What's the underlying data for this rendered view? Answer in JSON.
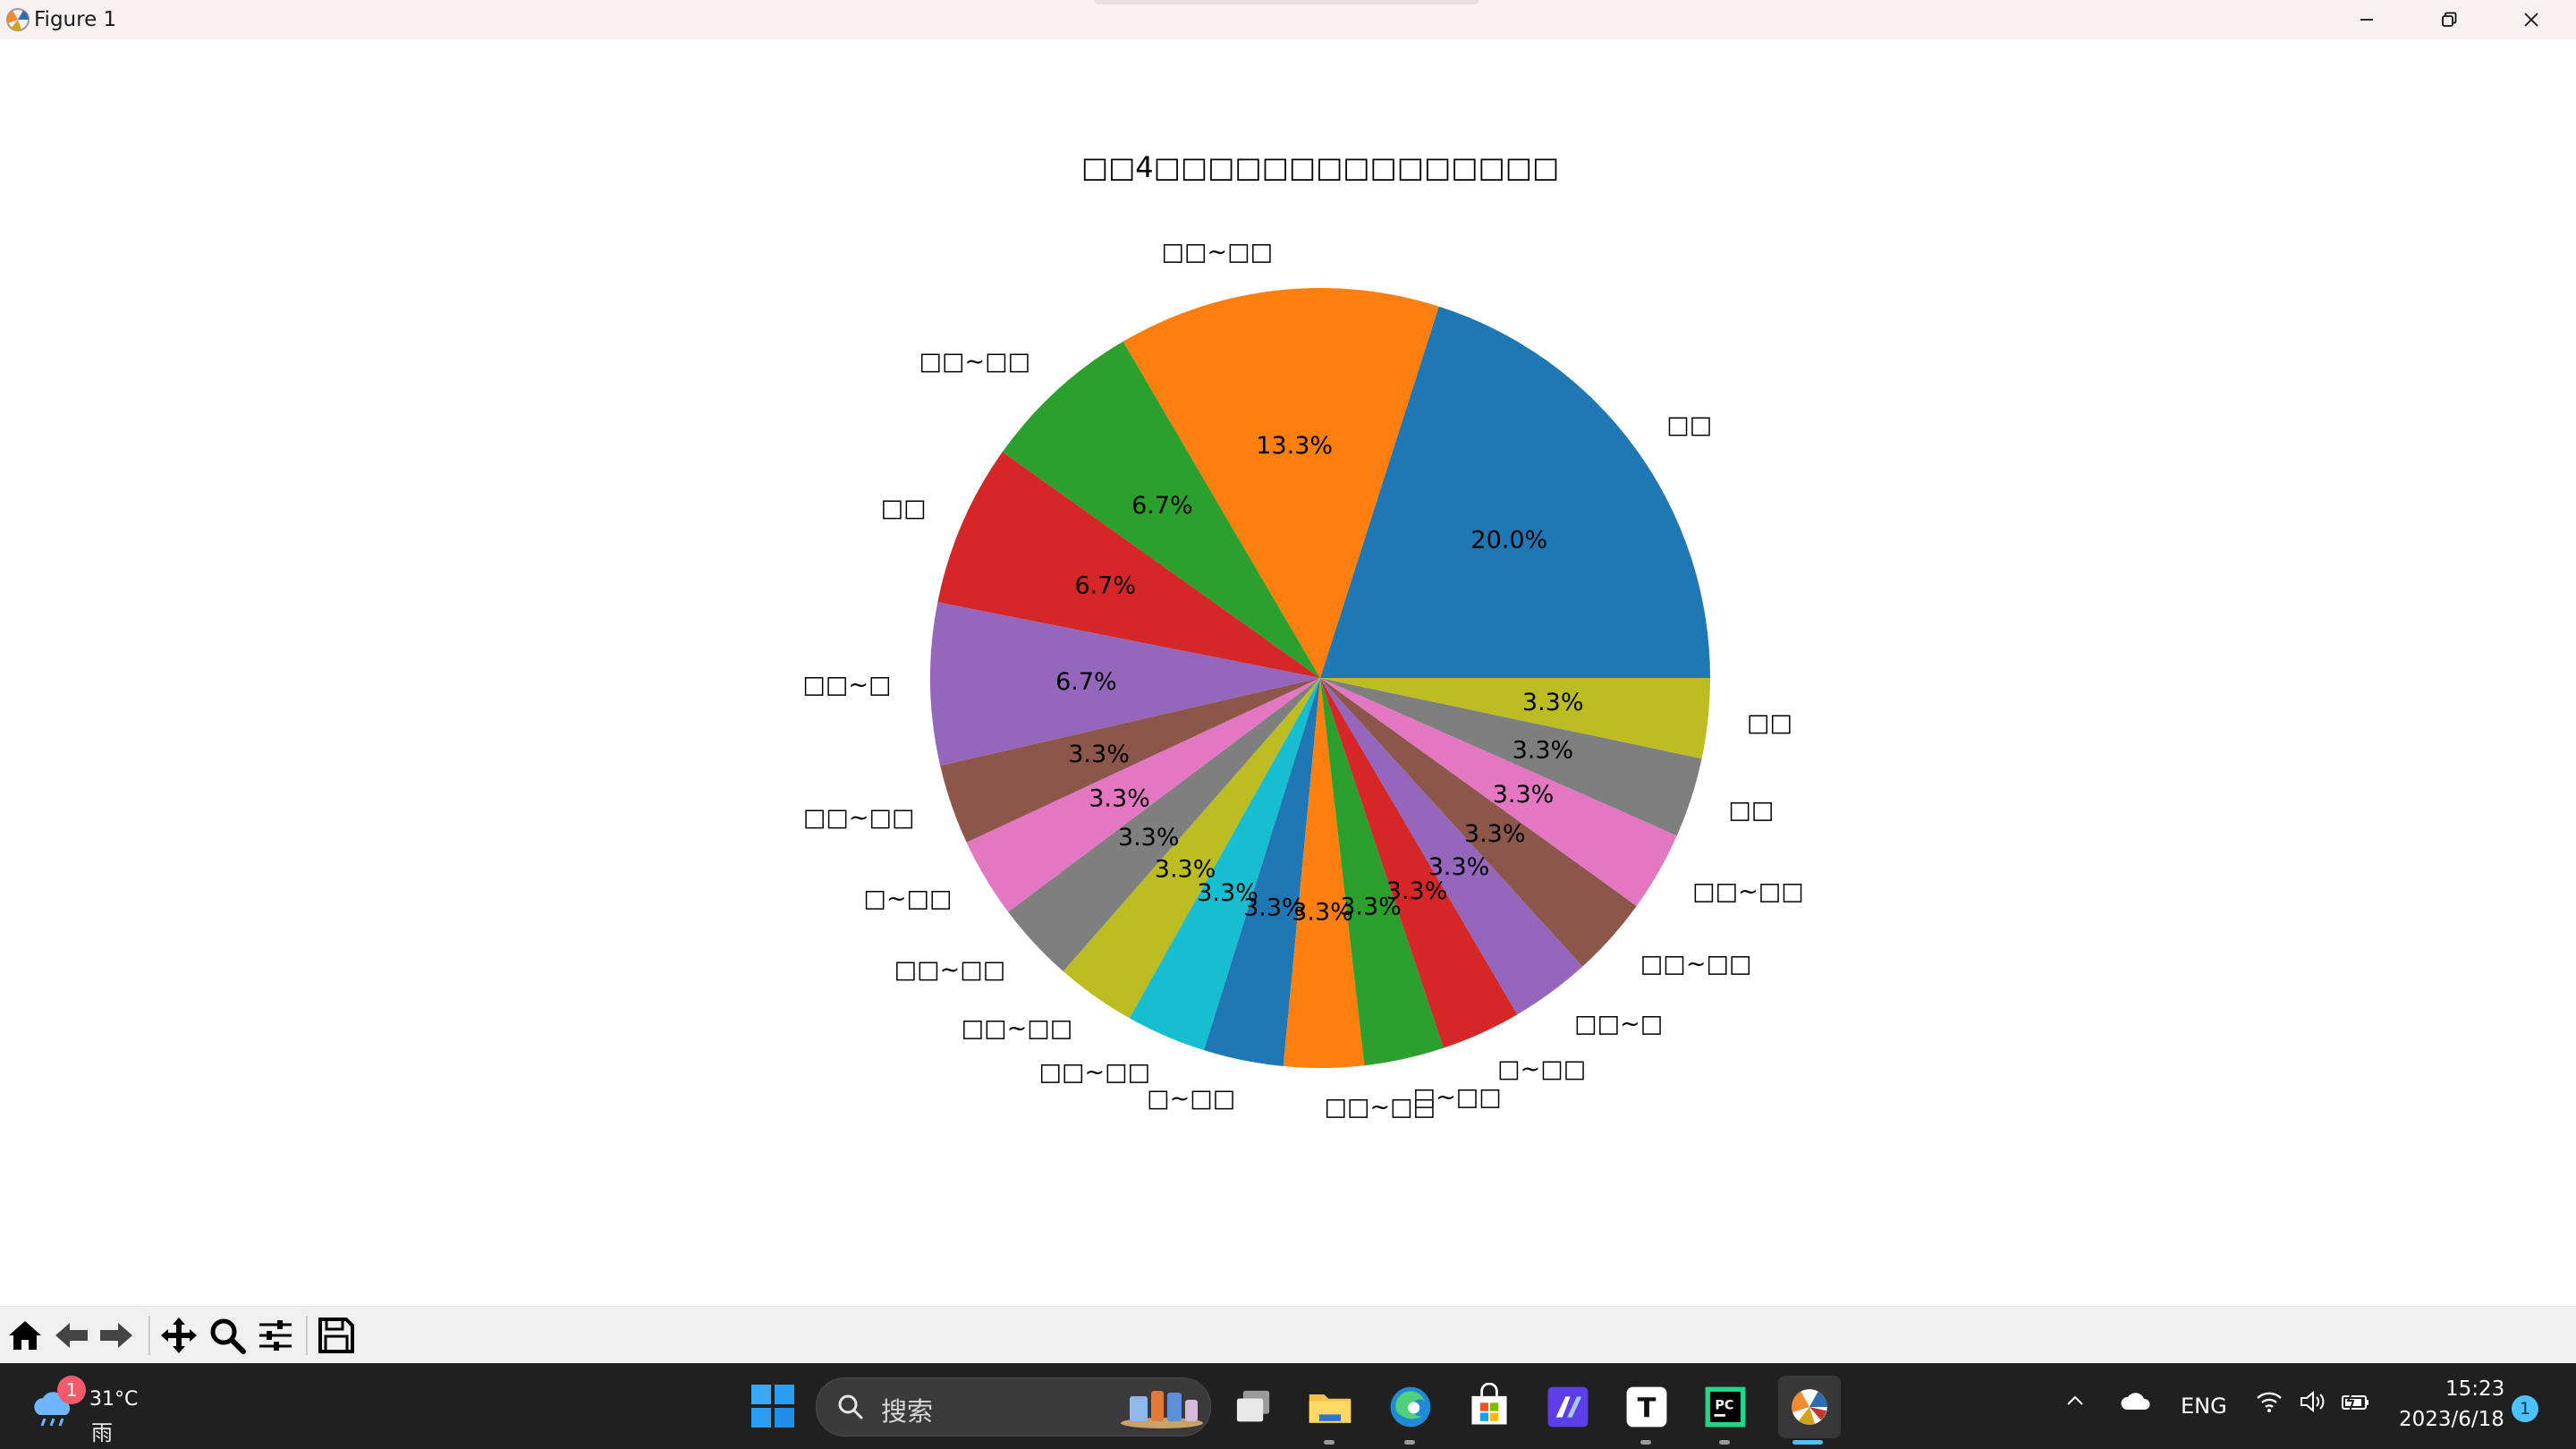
{
  "window": {
    "title": "Figure 1",
    "minimize_icon": "minimize-icon",
    "maximize_icon": "restore-icon",
    "close_icon": "close-icon"
  },
  "chart_data": {
    "type": "pie",
    "title": "□□4□□□□□□□□□□□□□□□",
    "labels": [
      "□□",
      "□□~□□",
      "□□~□□",
      "□□",
      "□□~□",
      "□□~□□",
      "□~□□",
      "□□~□□",
      "□□~□□",
      "□□~□□",
      "□~□□",
      "□□~□□",
      "□~□□",
      "□~□□",
      "□□~□",
      "□□~□□",
      "□□~□□",
      "□□",
      "□□"
    ],
    "values": [
      20.0,
      13.3,
      6.7,
      6.7,
      6.7,
      3.3,
      3.3,
      3.3,
      3.3,
      3.3,
      3.3,
      3.3,
      3.3,
      3.3,
      3.3,
      3.3,
      3.3,
      3.3,
      3.3
    ],
    "pct_labels": [
      "20.0%",
      "13.3%",
      "6.7%",
      "6.7%",
      "6.7%",
      "3.3%",
      "3.3%",
      "3.3%",
      "3.3%",
      "3.3%",
      "3.3%",
      "3.3%",
      "3.3%",
      "3.3%",
      "3.3%",
      "3.3%",
      "3.3%",
      "3.3%",
      "3.3%"
    ],
    "colors": [
      "#1f77b4",
      "#ff7f0e",
      "#2ca02c",
      "#d62728",
      "#9467bd",
      "#8c564b",
      "#e377c2",
      "#7f7f7f",
      "#bcbd22",
      "#17becf",
      "#1f77b4",
      "#ff7f0e",
      "#2ca02c",
      "#d62728",
      "#9467bd",
      "#8c564b",
      "#e377c2",
      "#7f7f7f",
      "#bcbd22"
    ],
    "start_angle_deg": 0,
    "direction": "counterclockwise"
  },
  "toolbar": {
    "buttons": [
      {
        "icon": "home-icon"
      },
      {
        "icon": "back-arrow-icon"
      },
      {
        "icon": "forward-arrow-icon"
      },
      {
        "icon": "pan-icon"
      },
      {
        "icon": "zoom-icon"
      },
      {
        "icon": "configure-subplots-icon"
      },
      {
        "icon": "save-icon"
      }
    ]
  },
  "taskbar": {
    "weather": {
      "badge": "1",
      "temp": "31°C",
      "condition": "雨",
      "icon": "rain-cloud-icon"
    },
    "search_placeholder": "搜索",
    "apps": [
      {
        "icon": "windows-start-icon"
      },
      {
        "icon": "task-view-icon"
      },
      {
        "icon": "file-explorer-icon"
      },
      {
        "icon": "edge-browser-icon"
      },
      {
        "icon": "microsoft-store-icon"
      },
      {
        "icon": "app-purple-icon"
      },
      {
        "icon": "typora-icon",
        "letter": "T"
      },
      {
        "icon": "pycharm-icon",
        "letter": "PC"
      },
      {
        "icon": "matplotlib-figure-icon"
      }
    ],
    "tray": {
      "language": "ENG",
      "time": "15:23",
      "date": "2023/6/18",
      "notification_count": "1"
    },
    "accent_color": "#4cc2ff"
  }
}
